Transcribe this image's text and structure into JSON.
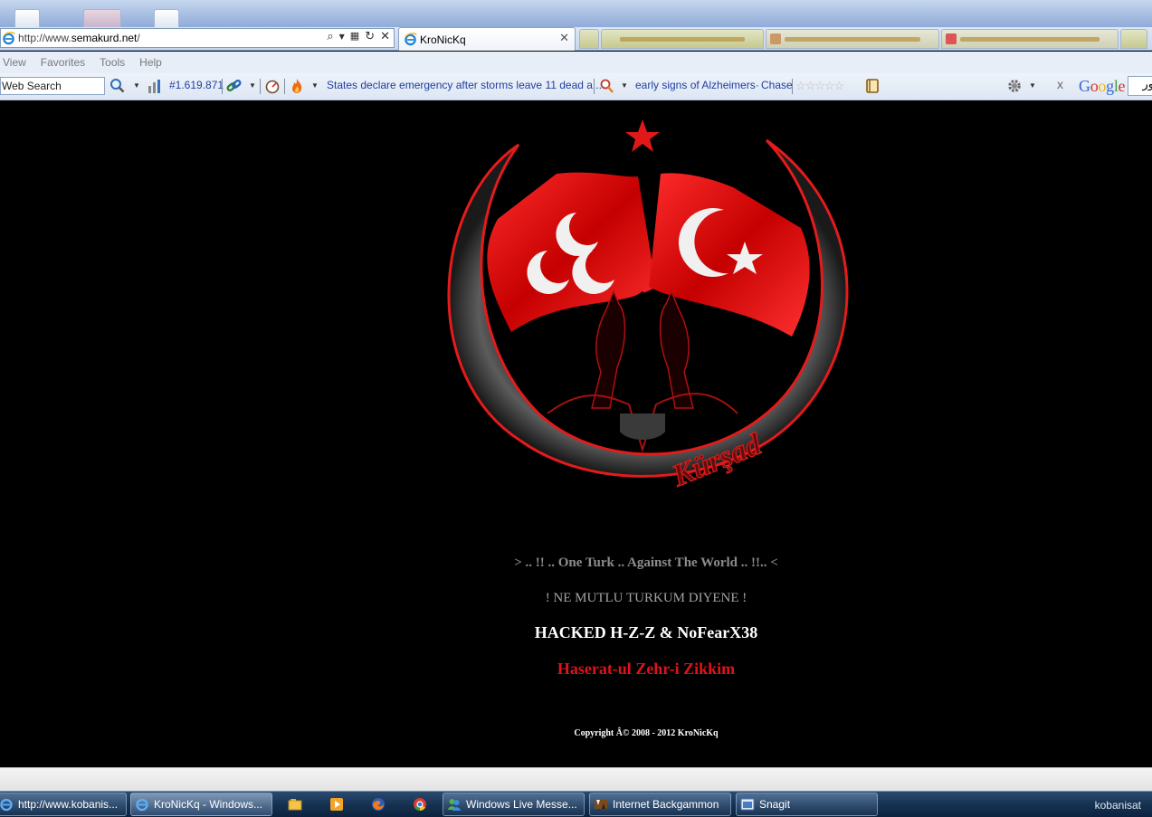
{
  "browser": {
    "address": {
      "prefix": "http://www.",
      "domain": "semakurd.net",
      "suffix": "/"
    },
    "active_tab": {
      "label": "KroNicKq"
    }
  },
  "menu": {
    "items": [
      "View",
      "Favorites",
      "Tools",
      "Help"
    ]
  },
  "toolbar": {
    "search_value": "Web Search",
    "rank": "#1.619.871",
    "news_headline": "States declare emergency after storms leave 11 dead a...",
    "news2": "early signs of Alzheimers·",
    "news2_link": "Chase",
    "rating_stars": "☆☆☆☆☆",
    "google_close": "x",
    "google_box": "ور"
  },
  "page": {
    "emblem_signature": "Kürşad",
    "line1": "> .. !! .. One Turk .. Against The World .. !!.. <",
    "line2": "! NE MUTLU TURKUM DIYENE !",
    "line3": "HACKED H-Z-Z & NoFearX38",
    "line4": "Haserat-ul Zehr-i Zikkim",
    "copyright": "Copyright Â© 2008 - 2012 KroNicKq"
  },
  "taskbar": {
    "items": [
      {
        "label": "http://www.kobanis..."
      },
      {
        "label": "KroNicKq - Windows..."
      },
      {
        "label": "Windows Live Messe..."
      },
      {
        "label": "Internet Backgammon"
      },
      {
        "label": "Snagit"
      }
    ],
    "tray_label": "kobanisat"
  },
  "colors": {
    "page_bg": "#000000",
    "accent_red": "#e0121a",
    "link_blue": "#1f3fa3"
  }
}
